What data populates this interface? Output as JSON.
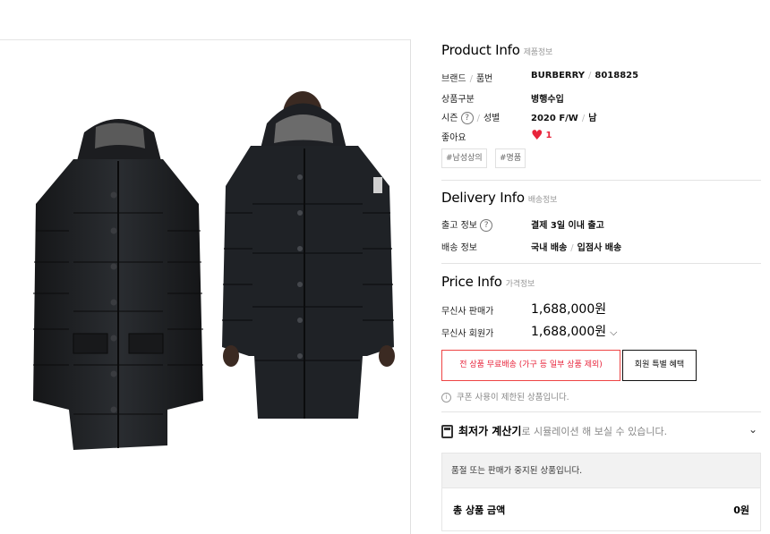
{
  "product_info": {
    "title": "Product Info",
    "subtitle": "제품정보",
    "brand_label": "브랜드",
    "item_no_label": "품번",
    "brand": "BURBERRY",
    "item_no": "8018825",
    "category_label": "상품구분",
    "category": "병행수입",
    "season_label": "시즌",
    "gender_label": "성별",
    "season": "2020 F/W",
    "gender": "남",
    "likes_label": "좋아요",
    "likes": "1",
    "tags": [
      "#남성상의",
      "#명품"
    ],
    "help_icon": "?",
    "heart_icon": "♥"
  },
  "delivery_info": {
    "title": "Delivery Info",
    "subtitle": "배송정보",
    "shipping_label": "출고 정보",
    "shipping": "결제 3일 이내 출고",
    "delivery_label": "배송 정보",
    "delivery_domestic": "국내 배송",
    "delivery_partner": "입점사 배송"
  },
  "price_info": {
    "title": "Price Info",
    "subtitle": "가격정보",
    "sale_label": "무신사 판매가",
    "sale_price": "1,688,000원",
    "member_label": "무신사 회원가",
    "member_price": "1,688,000원",
    "chevron": "⌵"
  },
  "buttons": {
    "free_shipping": "전 상품 무료배송 (가구 등 일부 상품 제외)",
    "member_benefit": "회원 특별 혜택"
  },
  "notice": {
    "icon": "i",
    "text": "쿠폰 사용이 제한된 상품입니다."
  },
  "calculator": {
    "bold": "최저가 계산기",
    "desc": "로 시뮬레이션 해 보실 수 있습니다.",
    "chevron": "⌄"
  },
  "sold_out_text": "품절 또는 판매가 중지된 상품입니다.",
  "total": {
    "label": "총 상품 금액",
    "value": "0원"
  },
  "colors": {
    "accent_red": "#e8243b",
    "coat": "#1d1f22"
  }
}
